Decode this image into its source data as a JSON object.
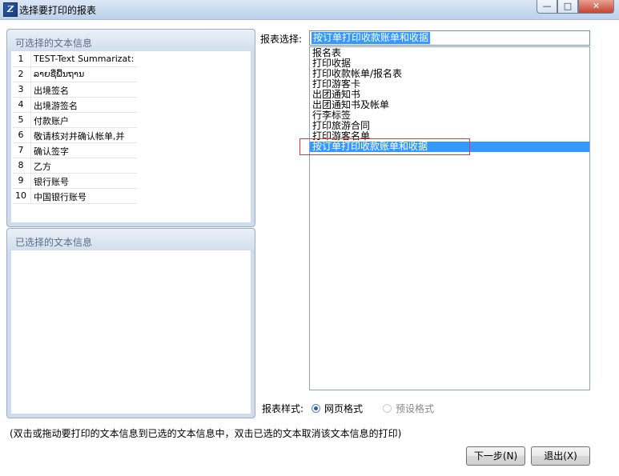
{
  "window": {
    "title": "选择要打印的报表",
    "icon_glyph": "Z",
    "controls": {
      "minimize": "—",
      "maximize": "□",
      "close": "✕"
    }
  },
  "available_panel": {
    "title": "可选择的文本信息",
    "rows": [
      {
        "num": "1",
        "text": "TEST-Text Summarizat:"
      },
      {
        "num": "2",
        "text": "ລາຍຊື່ພື້ນຖານ"
      },
      {
        "num": "3",
        "text": "出境签名"
      },
      {
        "num": "4",
        "text": "出境游签名"
      },
      {
        "num": "5",
        "text": "付款账户"
      },
      {
        "num": "6",
        "text": "敬请核对并确认帐单,并"
      },
      {
        "num": "7",
        "text": "确认签字"
      },
      {
        "num": "8",
        "text": "乙方"
      },
      {
        "num": "9",
        "text": "银行账号"
      },
      {
        "num": "10",
        "text": "中国银行账号"
      }
    ]
  },
  "selected_panel": {
    "title": "已选择的文本信息"
  },
  "report_select": {
    "label": "报表选择:",
    "value": "按订单打印收款账单和收据",
    "options": [
      "报名表",
      "打印收据",
      "打印收款帐单/报名表",
      "打印游客卡",
      "出团通知书",
      "出团通知书及帐单",
      "行李标签",
      "打印旅游合同",
      "打印游客名单",
      "按订单打印收款账单和收据"
    ],
    "selected_index": 9
  },
  "report_style": {
    "label": "报表样式:",
    "options": [
      {
        "label": "网页格式",
        "checked": true,
        "enabled": true
      },
      {
        "label": "预设格式",
        "checked": false,
        "enabled": false
      }
    ]
  },
  "hint": "(双击或拖动要打印的文本信息到已选的文本信息中，双击已选的文本取消该文本信息的打印)",
  "buttons": {
    "next": "下一步(N)",
    "exit": "退出(X)"
  },
  "colors": {
    "selection": "#3399ff",
    "highlight_border": "#e03a3a",
    "panel_bg": "#cfdced"
  }
}
